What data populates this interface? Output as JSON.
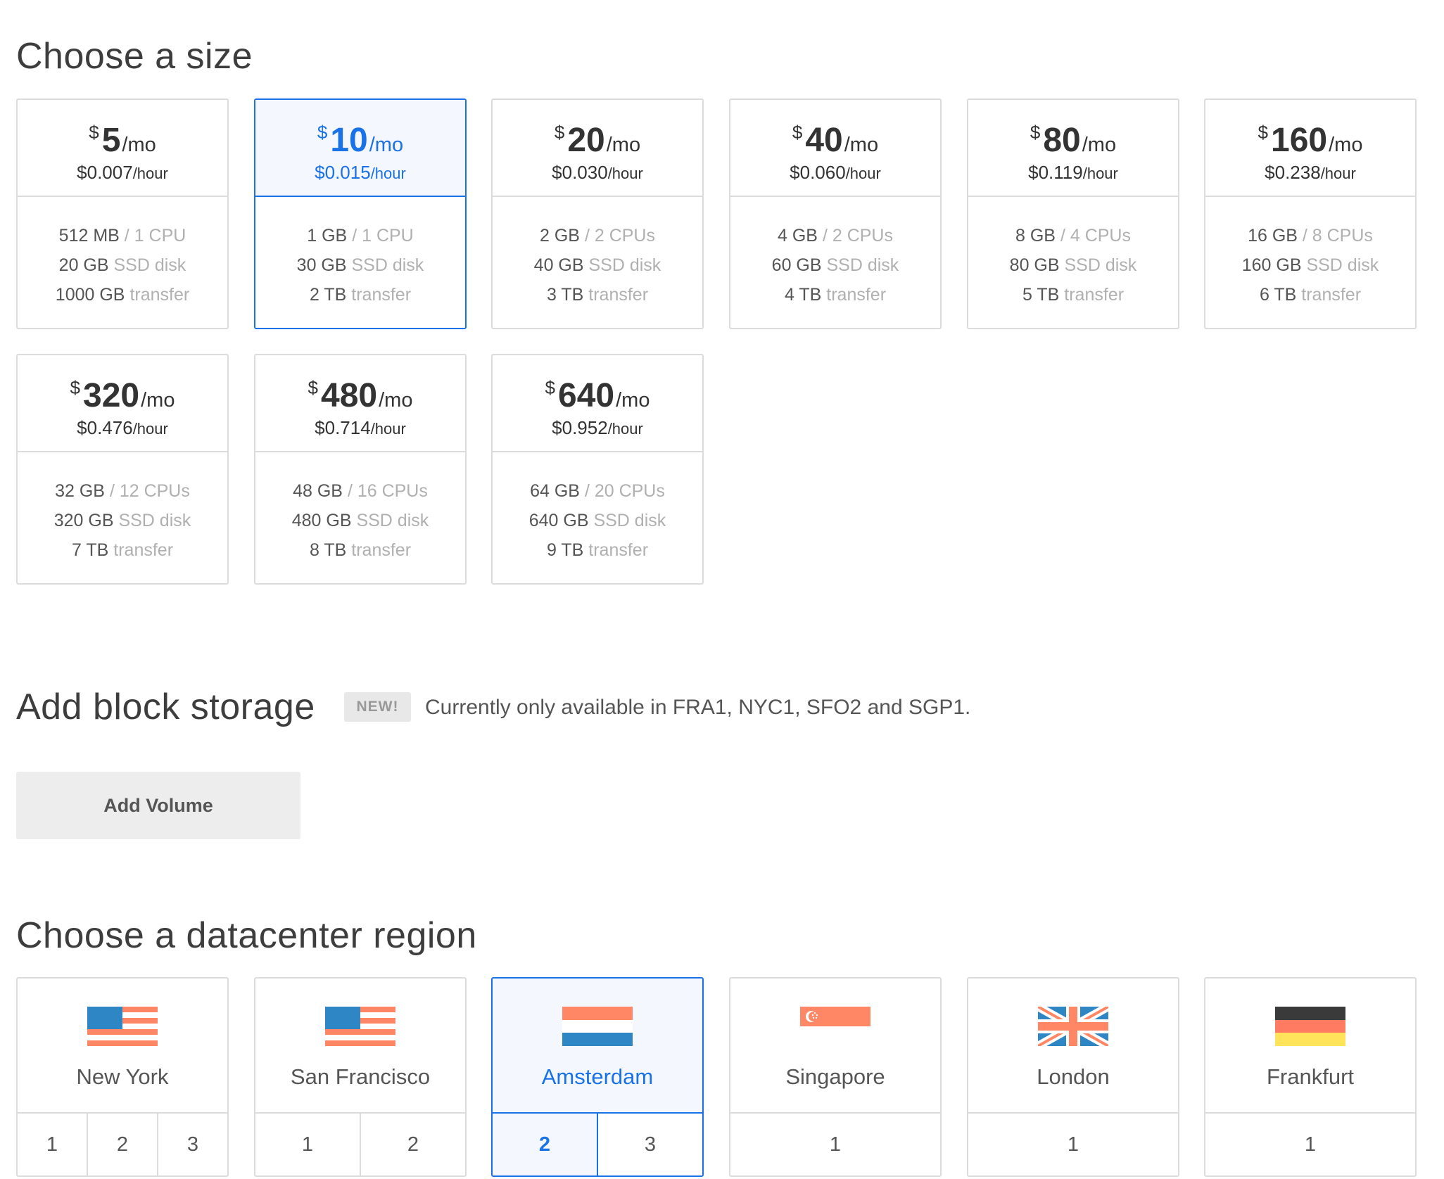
{
  "sizes_section": {
    "title": "Choose a size"
  },
  "sizes": [
    {
      "currency": "$",
      "amount": "5",
      "per": "/mo",
      "hourly": "$0.007",
      "hourly_unit": "/hour",
      "memory": "512 MB",
      "cpu": "/ 1 CPU",
      "disk": "20 GB",
      "disk_label": "SSD disk",
      "transfer": "1000 GB",
      "transfer_label": "transfer"
    },
    {
      "currency": "$",
      "amount": "10",
      "per": "/mo",
      "hourly": "$0.015",
      "hourly_unit": "/hour",
      "memory": "1 GB",
      "cpu": "/ 1 CPU",
      "disk": "30 GB",
      "disk_label": "SSD disk",
      "transfer": "2 TB",
      "transfer_label": "transfer",
      "selected": true
    },
    {
      "currency": "$",
      "amount": "20",
      "per": "/mo",
      "hourly": "$0.030",
      "hourly_unit": "/hour",
      "memory": "2 GB",
      "cpu": "/ 2 CPUs",
      "disk": "40 GB",
      "disk_label": "SSD disk",
      "transfer": "3 TB",
      "transfer_label": "transfer"
    },
    {
      "currency": "$",
      "amount": "40",
      "per": "/mo",
      "hourly": "$0.060",
      "hourly_unit": "/hour",
      "memory": "4 GB",
      "cpu": "/ 2 CPUs",
      "disk": "60 GB",
      "disk_label": "SSD disk",
      "transfer": "4 TB",
      "transfer_label": "transfer"
    },
    {
      "currency": "$",
      "amount": "80",
      "per": "/mo",
      "hourly": "$0.119",
      "hourly_unit": "/hour",
      "memory": "8 GB",
      "cpu": "/ 4 CPUs",
      "disk": "80 GB",
      "disk_label": "SSD disk",
      "transfer": "5 TB",
      "transfer_label": "transfer"
    },
    {
      "currency": "$",
      "amount": "160",
      "per": "/mo",
      "hourly": "$0.238",
      "hourly_unit": "/hour",
      "memory": "16 GB",
      "cpu": "/ 8 CPUs",
      "disk": "160 GB",
      "disk_label": "SSD disk",
      "transfer": "6 TB",
      "transfer_label": "transfer"
    },
    {
      "currency": "$",
      "amount": "320",
      "per": "/mo",
      "hourly": "$0.476",
      "hourly_unit": "/hour",
      "memory": "32 GB",
      "cpu": "/ 12 CPUs",
      "disk": "320 GB",
      "disk_label": "SSD disk",
      "transfer": "7 TB",
      "transfer_label": "transfer"
    },
    {
      "currency": "$",
      "amount": "480",
      "per": "/mo",
      "hourly": "$0.714",
      "hourly_unit": "/hour",
      "memory": "48 GB",
      "cpu": "/ 16 CPUs",
      "disk": "480 GB",
      "disk_label": "SSD disk",
      "transfer": "8 TB",
      "transfer_label": "transfer"
    },
    {
      "currency": "$",
      "amount": "640",
      "per": "/mo",
      "hourly": "$0.952",
      "hourly_unit": "/hour",
      "memory": "64 GB",
      "cpu": "/ 20 CPUs",
      "disk": "640 GB",
      "disk_label": "SSD disk",
      "transfer": "9 TB",
      "transfer_label": "transfer"
    }
  ],
  "storage_section": {
    "title": "Add block storage",
    "badge": "NEW!",
    "availability": "Currently only available in FRA1, NYC1, SFO2 and SGP1.",
    "button_label": "Add Volume"
  },
  "region_section": {
    "title": "Choose a datacenter region"
  },
  "regions": [
    {
      "name": "New York",
      "flag": "us-flag-icon",
      "numbers": [
        "1",
        "2",
        "3"
      ]
    },
    {
      "name": "San Francisco",
      "flag": "us-flag-icon",
      "numbers": [
        "1",
        "2"
      ]
    },
    {
      "name": "Amsterdam",
      "flag": "netherlands-flag-icon",
      "numbers": [
        "2",
        "3"
      ],
      "selected": true,
      "selected_number": "2"
    },
    {
      "name": "Singapore",
      "flag": "singapore-flag-icon",
      "numbers": [
        "1"
      ]
    },
    {
      "name": "London",
      "flag": "uk-flag-icon",
      "numbers": [
        "1"
      ]
    },
    {
      "name": "Frankfurt",
      "flag": "germany-flag-icon",
      "numbers": [
        "1"
      ]
    }
  ],
  "colors": {
    "accent": "#1a72e8",
    "flag_red": "#ff8766",
    "flag_blue": "#2f86c5"
  }
}
